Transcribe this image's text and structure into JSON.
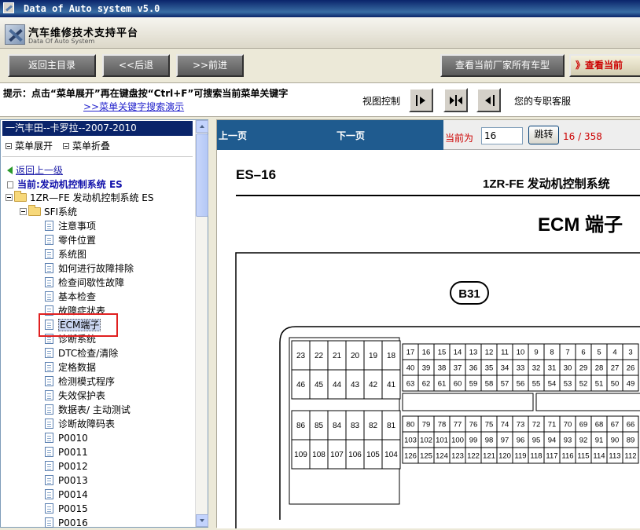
{
  "window": {
    "title": "Data of Auto system v5.0"
  },
  "app": {
    "name": "汽车维修技术支持平台",
    "subtitle": "Data Of Auto System"
  },
  "toolbar": {
    "home": "返回主目录",
    "back": "<<后退",
    "forward": ">>前进",
    "all_models": "查看当前厂家所有车型",
    "current": "》查看当前"
  },
  "hint": {
    "text": "提示：点击“菜单展开”再在键盘按“Ctrl+F”可搜索当前菜单关键字",
    "link": ">>菜单关键字搜索演示",
    "view_control": "视图控制",
    "support": "您的专职客服"
  },
  "sidebar": {
    "model": "一汽丰田--卡罗拉--2007-2010",
    "expand": "菜单展开",
    "collapse": "菜单折叠",
    "back_level": "返回上一级",
    "current": "当前:发动机控制系统  ES",
    "tree_root": "1ZR—FE 发动机控制系统  ES",
    "tree_folder": "SFI系统",
    "items": [
      "注意事项",
      "零件位置",
      "系统图",
      "如何进行故障排除",
      "检查间歇性故障",
      "基本检查",
      "故障症状表",
      "ECM端子",
      "诊断系统",
      "DTC检查/清除",
      "定格数据",
      "检测模式程序",
      "失效保护表",
      "数据表/ 主动测试",
      "诊断故障码表",
      "P0010",
      "P0011",
      "P0012",
      "P0013",
      "P0014",
      "P0015",
      "P0016"
    ],
    "selected_index": 7
  },
  "nav": {
    "prev": "上一页",
    "next": "下一页",
    "current_label": "当前为",
    "page_value": "16",
    "jump": "跳转",
    "count": "16 / 358"
  },
  "doc": {
    "code": "ES–16",
    "system": "1ZR-FE 发动机控制系统",
    "heading": "ECM 端子",
    "connector": "B31",
    "block_a": [
      [
        "23",
        "22",
        "21",
        "20",
        "19",
        "18"
      ],
      [
        "46",
        "45",
        "44",
        "43",
        "42",
        "41"
      ]
    ],
    "block_b": [
      [
        "86",
        "85",
        "84",
        "83",
        "82",
        "81"
      ],
      [
        "109",
        "108",
        "107",
        "106",
        "105",
        "104"
      ]
    ],
    "block_c": [
      [
        "17",
        "16",
        "15",
        "14",
        "13",
        "12",
        "11",
        "10",
        "9",
        "8",
        "7",
        "6",
        "5",
        "4",
        "3"
      ],
      [
        "40",
        "39",
        "38",
        "37",
        "36",
        "35",
        "34",
        "33",
        "32",
        "31",
        "30",
        "29",
        "28",
        "27",
        "26"
      ],
      [
        "63",
        "62",
        "61",
        "60",
        "59",
        "58",
        "57",
        "56",
        "55",
        "54",
        "53",
        "52",
        "51",
        "50",
        "49"
      ]
    ],
    "block_d": [
      [
        "80",
        "79",
        "78",
        "77",
        "76",
        "75",
        "74",
        "73",
        "72",
        "71",
        "70",
        "69",
        "68",
        "67",
        "66"
      ],
      [
        "103",
        "102",
        "101",
        "100",
        "99",
        "98",
        "97",
        "96",
        "95",
        "94",
        "93",
        "92",
        "91",
        "90",
        "89"
      ],
      [
        "126",
        "125",
        "124",
        "123",
        "122",
        "121",
        "120",
        "119",
        "118",
        "117",
        "116",
        "115",
        "114",
        "113",
        "112"
      ]
    ]
  }
}
